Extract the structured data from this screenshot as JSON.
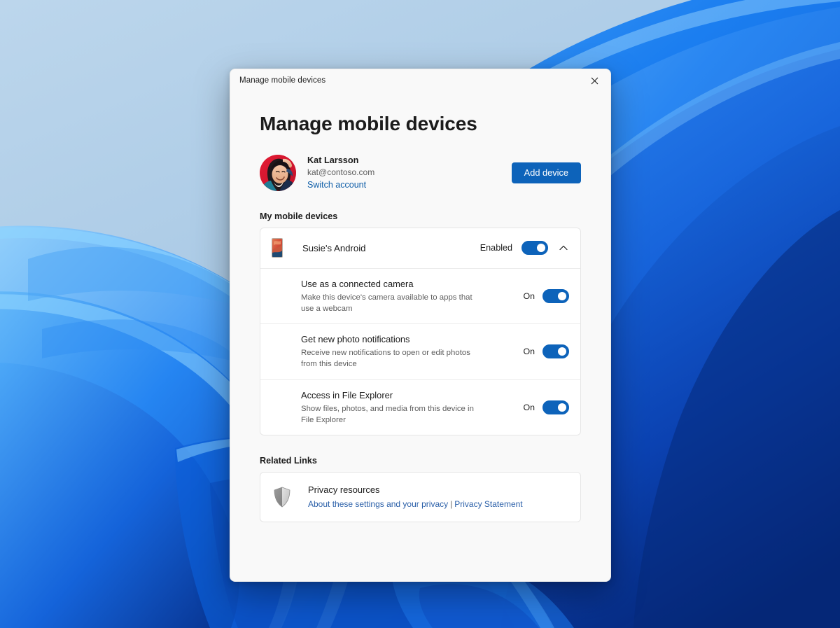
{
  "window": {
    "titlebar_text": "Manage mobile devices",
    "close_icon": "close-icon"
  },
  "page": {
    "title": "Manage mobile devices"
  },
  "account": {
    "name": "Kat Larsson",
    "email": "kat@contoso.com",
    "switch_account_label": "Switch account",
    "avatar_icon": "user-avatar-photo",
    "add_device_label": "Add device"
  },
  "devices_section": {
    "heading": "My mobile devices",
    "device": {
      "name": "Susie's Android",
      "thumb_icon": "phone-thumbnail",
      "state_label": "Enabled",
      "toggle_on": true,
      "expand_icon": "chevron-up-icon",
      "expanded": true
    },
    "settings": [
      {
        "title": "Use as a connected camera",
        "description": "Make this device's camera available to apps that use a webcam",
        "state_label": "On",
        "toggle_on": true
      },
      {
        "title": "Get new photo notifications",
        "description": "Receive new notifications to open or edit photos from this device",
        "state_label": "On",
        "toggle_on": true
      },
      {
        "title": "Access in File Explorer",
        "description": "Show files, photos, and media from this device in File Explorer",
        "state_label": "On",
        "toggle_on": true
      }
    ]
  },
  "related_links": {
    "heading": "Related Links",
    "privacy": {
      "icon": "shield-icon",
      "title": "Privacy resources",
      "link1": "About these settings and your privacy",
      "separator": "|",
      "link2": "Privacy Statement"
    }
  },
  "colors": {
    "accent": "#0d63ba",
    "link": "#2a5fa8",
    "dialog_bg": "#f9f9f9",
    "card_bg": "#ffffff",
    "text_primary": "#1b1b1b",
    "text_secondary": "#5d5d5d"
  }
}
